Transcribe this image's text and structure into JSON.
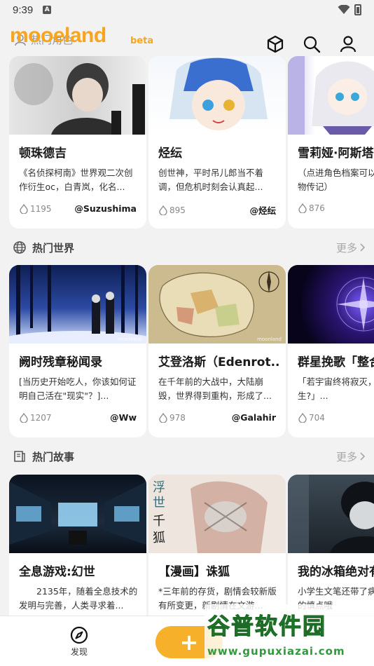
{
  "status_bar": {
    "time": "9:39",
    "notification_badge": "A"
  },
  "header": {
    "logo": "mooeland",
    "beta": "beta",
    "ghost_section_title": "热门角色",
    "icons": [
      "cube-icon",
      "search-icon",
      "user-icon"
    ]
  },
  "sections": [
    {
      "id": "characters",
      "title": "热门角色",
      "more": "",
      "cards": [
        {
          "title": "顿珠德吉",
          "desc": "《名侦探柯南》世界观二次创作衍生oc，白青岚，化名...",
          "heat": "1195",
          "author": "@Suzushima"
        },
        {
          "title": "烃纭",
          "desc": "创世神，平时吊儿郎当不着调，但危机时刻会认真起...",
          "heat": "895",
          "author": "@烃纭"
        },
        {
          "title": "雪莉娅·阿斯塔",
          "desc": "（点进角色档案可以曲还有人物传记）",
          "heat": "876",
          "author": ""
        }
      ]
    },
    {
      "id": "worlds",
      "title": "热门世界",
      "more": "更多",
      "cards": [
        {
          "title": "阙时残章秘闻录",
          "desc": "[当历史开始吃人，你该如何证明自己活在\"现实\"？]...",
          "heat": "1207",
          "author": "@Ww"
        },
        {
          "title": "艾登洛斯（Edenrot...",
          "desc": "在千年前的大战中，大陆崩毁，世界得到重构，形成了...",
          "heat": "978",
          "author": "@Galahir"
        },
        {
          "title": "群星挽歌「整合",
          "desc": "「若宇宙终将寂灭，有星光诞生?」...",
          "heat": "704",
          "author": "@"
        }
      ]
    },
    {
      "id": "stories",
      "title": "热门故事",
      "more": "更多",
      "cards": [
        {
          "title": "全息游戏:幻世",
          "desc": "2135年，随着全息技术的发明与完善，人类寻求着...",
          "heat": "",
          "author": ""
        },
        {
          "title": "【漫画】诛狐",
          "desc": "*三年前的存货，剧情会较新版有所变更，新剧情在文游...",
          "heat": "",
          "author": ""
        },
        {
          "title": "我的冰箱绝对有",
          "desc": "小学生文笔还带了病，真的真的慎点哦",
          "heat": "",
          "author": ""
        }
      ]
    }
  ],
  "bottom_nav": {
    "discover": "发现",
    "fab": "+"
  },
  "watermark": {
    "main": "谷普软件园",
    "url": "www.gupuxiazai.com"
  },
  "colors": {
    "accent": "#f7a51c",
    "fab": "#f7b02a",
    "watermark": "#2f9a3b"
  }
}
